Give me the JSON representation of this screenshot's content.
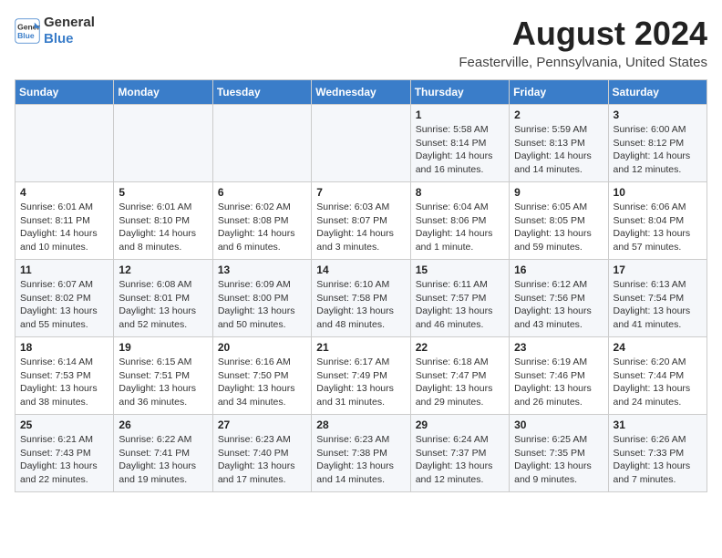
{
  "app": {
    "name": "GeneralBlue",
    "logo_text_part1": "General",
    "logo_text_part2": "Blue"
  },
  "header": {
    "month_year": "August 2024",
    "location": "Feasterville, Pennsylvania, United States"
  },
  "weekdays": [
    "Sunday",
    "Monday",
    "Tuesday",
    "Wednesday",
    "Thursday",
    "Friday",
    "Saturday"
  ],
  "rows": [
    [
      {
        "day": "",
        "info": ""
      },
      {
        "day": "",
        "info": ""
      },
      {
        "day": "",
        "info": ""
      },
      {
        "day": "",
        "info": ""
      },
      {
        "day": "1",
        "info": "Sunrise: 5:58 AM\nSunset: 8:14 PM\nDaylight: 14 hours\nand 16 minutes."
      },
      {
        "day": "2",
        "info": "Sunrise: 5:59 AM\nSunset: 8:13 PM\nDaylight: 14 hours\nand 14 minutes."
      },
      {
        "day": "3",
        "info": "Sunrise: 6:00 AM\nSunset: 8:12 PM\nDaylight: 14 hours\nand 12 minutes."
      }
    ],
    [
      {
        "day": "4",
        "info": "Sunrise: 6:01 AM\nSunset: 8:11 PM\nDaylight: 14 hours\nand 10 minutes."
      },
      {
        "day": "5",
        "info": "Sunrise: 6:01 AM\nSunset: 8:10 PM\nDaylight: 14 hours\nand 8 minutes."
      },
      {
        "day": "6",
        "info": "Sunrise: 6:02 AM\nSunset: 8:08 PM\nDaylight: 14 hours\nand 6 minutes."
      },
      {
        "day": "7",
        "info": "Sunrise: 6:03 AM\nSunset: 8:07 PM\nDaylight: 14 hours\nand 3 minutes."
      },
      {
        "day": "8",
        "info": "Sunrise: 6:04 AM\nSunset: 8:06 PM\nDaylight: 14 hours\nand 1 minute."
      },
      {
        "day": "9",
        "info": "Sunrise: 6:05 AM\nSunset: 8:05 PM\nDaylight: 13 hours\nand 59 minutes."
      },
      {
        "day": "10",
        "info": "Sunrise: 6:06 AM\nSunset: 8:04 PM\nDaylight: 13 hours\nand 57 minutes."
      }
    ],
    [
      {
        "day": "11",
        "info": "Sunrise: 6:07 AM\nSunset: 8:02 PM\nDaylight: 13 hours\nand 55 minutes."
      },
      {
        "day": "12",
        "info": "Sunrise: 6:08 AM\nSunset: 8:01 PM\nDaylight: 13 hours\nand 52 minutes."
      },
      {
        "day": "13",
        "info": "Sunrise: 6:09 AM\nSunset: 8:00 PM\nDaylight: 13 hours\nand 50 minutes."
      },
      {
        "day": "14",
        "info": "Sunrise: 6:10 AM\nSunset: 7:58 PM\nDaylight: 13 hours\nand 48 minutes."
      },
      {
        "day": "15",
        "info": "Sunrise: 6:11 AM\nSunset: 7:57 PM\nDaylight: 13 hours\nand 46 minutes."
      },
      {
        "day": "16",
        "info": "Sunrise: 6:12 AM\nSunset: 7:56 PM\nDaylight: 13 hours\nand 43 minutes."
      },
      {
        "day": "17",
        "info": "Sunrise: 6:13 AM\nSunset: 7:54 PM\nDaylight: 13 hours\nand 41 minutes."
      }
    ],
    [
      {
        "day": "18",
        "info": "Sunrise: 6:14 AM\nSunset: 7:53 PM\nDaylight: 13 hours\nand 38 minutes."
      },
      {
        "day": "19",
        "info": "Sunrise: 6:15 AM\nSunset: 7:51 PM\nDaylight: 13 hours\nand 36 minutes."
      },
      {
        "day": "20",
        "info": "Sunrise: 6:16 AM\nSunset: 7:50 PM\nDaylight: 13 hours\nand 34 minutes."
      },
      {
        "day": "21",
        "info": "Sunrise: 6:17 AM\nSunset: 7:49 PM\nDaylight: 13 hours\nand 31 minutes."
      },
      {
        "day": "22",
        "info": "Sunrise: 6:18 AM\nSunset: 7:47 PM\nDaylight: 13 hours\nand 29 minutes."
      },
      {
        "day": "23",
        "info": "Sunrise: 6:19 AM\nSunset: 7:46 PM\nDaylight: 13 hours\nand 26 minutes."
      },
      {
        "day": "24",
        "info": "Sunrise: 6:20 AM\nSunset: 7:44 PM\nDaylight: 13 hours\nand 24 minutes."
      }
    ],
    [
      {
        "day": "25",
        "info": "Sunrise: 6:21 AM\nSunset: 7:43 PM\nDaylight: 13 hours\nand 22 minutes."
      },
      {
        "day": "26",
        "info": "Sunrise: 6:22 AM\nSunset: 7:41 PM\nDaylight: 13 hours\nand 19 minutes."
      },
      {
        "day": "27",
        "info": "Sunrise: 6:23 AM\nSunset: 7:40 PM\nDaylight: 13 hours\nand 17 minutes."
      },
      {
        "day": "28",
        "info": "Sunrise: 6:23 AM\nSunset: 7:38 PM\nDaylight: 13 hours\nand 14 minutes."
      },
      {
        "day": "29",
        "info": "Sunrise: 6:24 AM\nSunset: 7:37 PM\nDaylight: 13 hours\nand 12 minutes."
      },
      {
        "day": "30",
        "info": "Sunrise: 6:25 AM\nSunset: 7:35 PM\nDaylight: 13 hours\nand 9 minutes."
      },
      {
        "day": "31",
        "info": "Sunrise: 6:26 AM\nSunset: 7:33 PM\nDaylight: 13 hours\nand 7 minutes."
      }
    ]
  ]
}
